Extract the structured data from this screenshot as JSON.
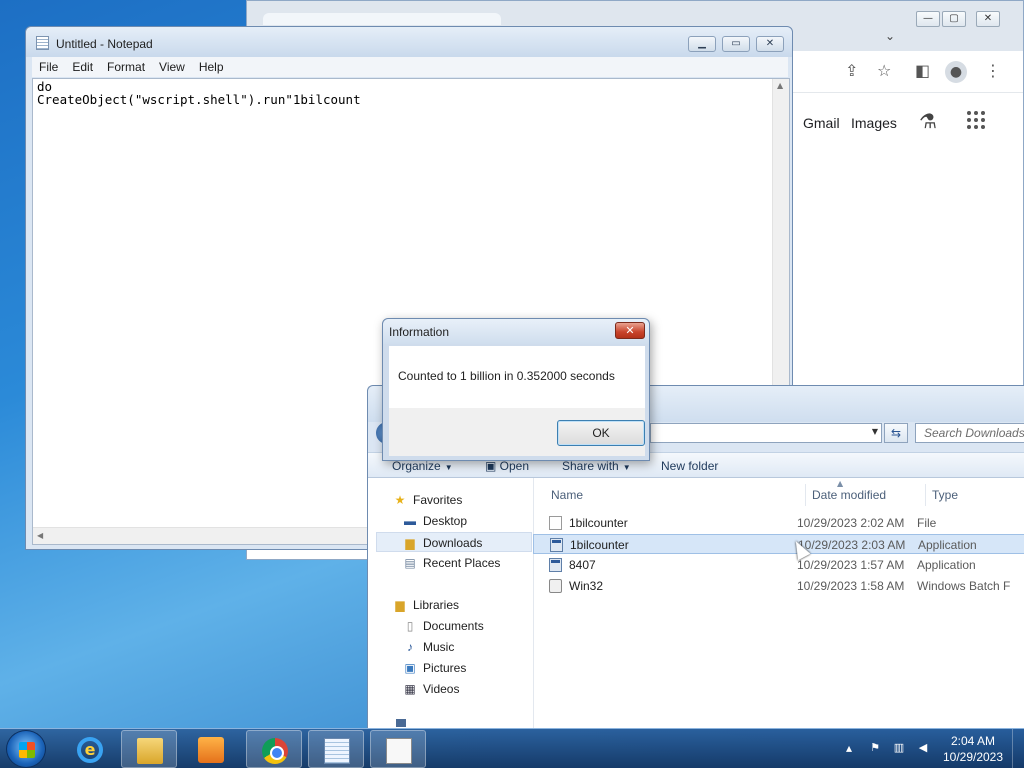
{
  "chrome": {
    "links": [
      "Gmail",
      "Images"
    ],
    "icons": [
      "share-icon",
      "star-icon",
      "sidepanel-icon",
      "profile-icon",
      "menu-icon",
      "labs-icon",
      "apps-icon"
    ]
  },
  "notepad": {
    "title": "Untitled - Notepad",
    "menu": [
      "File",
      "Edit",
      "Format",
      "View",
      "Help"
    ],
    "content": "do\nCreateObject(\"wscript.shell\").run\"1bilcount"
  },
  "dialog": {
    "title": "Information",
    "message": "Counted to 1 billion in 0.352000 seconds",
    "ok_label": "OK",
    "close_glyph": "✕"
  },
  "explorer": {
    "search_placeholder": "Search Downloads",
    "commands": {
      "organize": "Organize",
      "open": "Open",
      "share_with": "Share with",
      "new_folder": "New folder"
    },
    "nav": {
      "favorites": "Favorites",
      "desktop": "Desktop",
      "downloads": "Downloads",
      "recent_places": "Recent Places",
      "libraries": "Libraries",
      "documents": "Documents",
      "music": "Music",
      "pictures": "Pictures",
      "videos": "Videos"
    },
    "columns": {
      "name": "Name",
      "date": "Date modified",
      "type": "Type"
    },
    "files": [
      {
        "name": "1bilcounter",
        "date": "10/29/2023 2:02 AM",
        "type": "File",
        "icon": "file-icon"
      },
      {
        "name": "1bilcounter",
        "date": "10/29/2023 2:03 AM",
        "type": "Application",
        "icon": "application-icon",
        "selected": true
      },
      {
        "name": "8407",
        "date": "10/29/2023 1:57 AM",
        "type": "Application",
        "icon": "application-icon"
      },
      {
        "name": "Win32",
        "date": "10/29/2023 1:58 AM",
        "type": "Windows Batch F",
        "icon": "batch-file-icon"
      }
    ]
  },
  "taskbar": {
    "apps": [
      "Internet Explorer",
      "Windows Explorer",
      "Windows Media Player",
      "Google Chrome",
      "Notepad",
      "Document"
    ],
    "clock": {
      "time": "2:04 AM",
      "date": "10/29/2023"
    }
  }
}
